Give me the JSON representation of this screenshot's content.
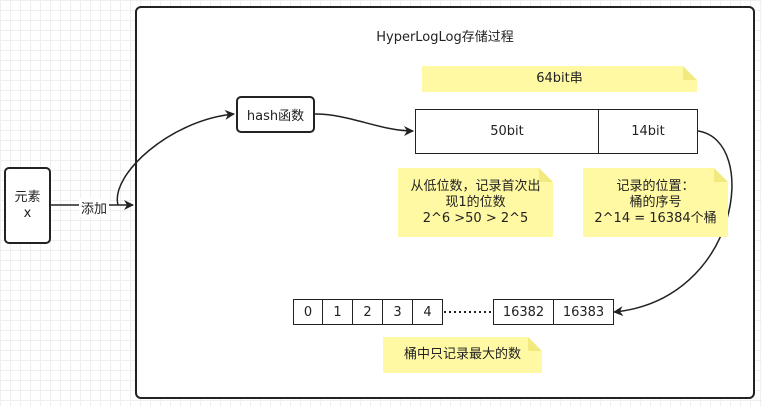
{
  "diagram": {
    "title": "HyperLogLog存储过程",
    "element_node": {
      "line1": "元素",
      "line2": "x"
    },
    "add_label": "添加",
    "hash_node": "hash函数",
    "note_64bit": "64bit串",
    "bits": {
      "low": "50bit",
      "high": "14bit"
    },
    "note_low": {
      "line1": "从低位数，记录首次出",
      "line2": "现1的位数",
      "line3": "2^6 >50 > 2^5"
    },
    "note_pos": {
      "line1": "记录的位置：",
      "line2": "桶的序号",
      "line3": "2^14 = 16384个桶"
    },
    "buckets": [
      "0",
      "1",
      "2",
      "3",
      "4",
      "16382",
      "16383"
    ],
    "note_bucket": "桶中只记录最大的数"
  }
}
